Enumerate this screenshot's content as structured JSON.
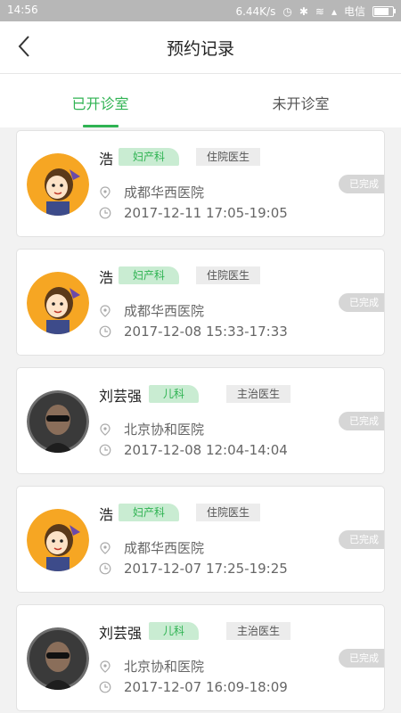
{
  "status_bar": {
    "time": "14:56",
    "net_speed": "6.44K/s",
    "carrier": "电信"
  },
  "header": {
    "title": "预约记录"
  },
  "tabs": [
    {
      "label": "已开诊室",
      "active": true
    },
    {
      "label": "未开诊室",
      "active": false
    }
  ],
  "colors": {
    "accent": "#2fb352",
    "dept_bg": "#c9ecd2",
    "status_bg": "#d6d6d6"
  },
  "records": [
    {
      "doctor": "浩",
      "department": "妇产科",
      "title": "住院医生",
      "hospital": "成都华西医院",
      "time": "2017-12-11 17:05-19:05",
      "status": "已完成",
      "avatar": "cartoon-avatar"
    },
    {
      "doctor": "浩",
      "department": "妇产科",
      "title": "住院医生",
      "hospital": "成都华西医院",
      "time": "2017-12-08 15:33-17:33",
      "status": "已完成",
      "avatar": "cartoon-avatar"
    },
    {
      "doctor": "刘芸强",
      "department": "儿科",
      "title": "主治医生",
      "hospital": "北京协和医院",
      "time": "2017-12-08 12:04-14:04",
      "status": "已完成",
      "avatar": "photo-avatar"
    },
    {
      "doctor": "浩",
      "department": "妇产科",
      "title": "住院医生",
      "hospital": "成都华西医院",
      "time": "2017-12-07 17:25-19:25",
      "status": "已完成",
      "avatar": "cartoon-avatar"
    },
    {
      "doctor": "刘芸强",
      "department": "儿科",
      "title": "主治医生",
      "hospital": "北京协和医院",
      "time": "2017-12-07 16:09-18:09",
      "status": "已完成",
      "avatar": "photo-avatar"
    }
  ]
}
